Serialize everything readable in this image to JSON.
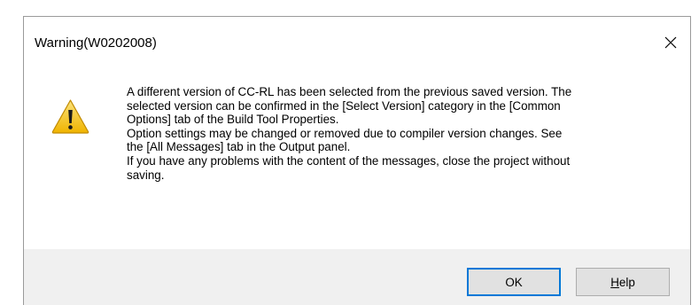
{
  "dialog": {
    "title": "Warning(W0202008)",
    "icon": "warning-icon",
    "message_lines": [
      "A different version of CC-RL has been selected from the previous saved version. The",
      "selected version can be confirmed in the [Select Version] category in the [Common",
      "Options] tab of the Build Tool Properties.",
      "Option settings may be changed or removed due to compiler version changes. See",
      "the [All Messages] tab in the Output panel.",
      "If you have any problems with the content of the messages, close the project without",
      "saving."
    ],
    "buttons": {
      "ok_label": "OK",
      "help_accel": "H",
      "help_rest": "elp"
    }
  },
  "colors": {
    "footer_background": "#f0f0f0",
    "button_background": "#e1e1e1",
    "default_button_border": "#0078d7",
    "warning_yellow": "#f5c518"
  }
}
